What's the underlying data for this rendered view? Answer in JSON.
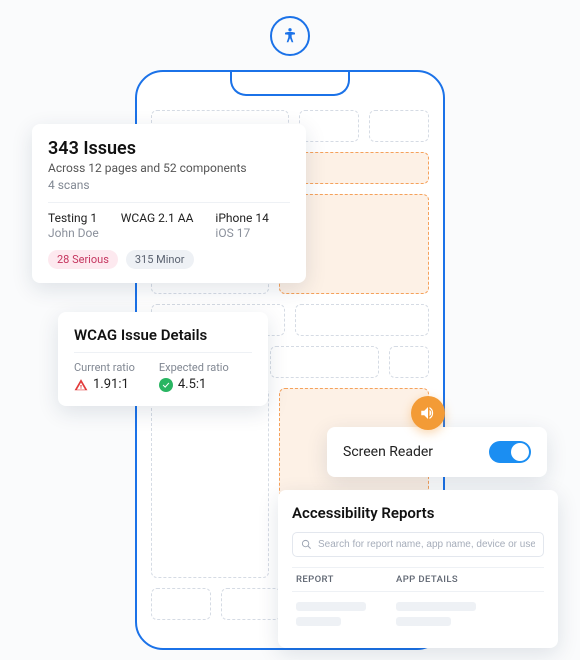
{
  "issues": {
    "title": "343 Issues",
    "subtitle": "Across 12 pages and 52 components",
    "scans": "4 scans",
    "meta": [
      {
        "line1": "Testing 1",
        "line2": "John Doe"
      },
      {
        "line1": "WCAG 2.1 AA",
        "line2": ""
      },
      {
        "line1": "iPhone 14",
        "line2": "iOS 17"
      }
    ],
    "badges": {
      "serious": "28 Serious",
      "minor": "315 Minor"
    }
  },
  "wcag": {
    "title": "WCAG Issue Details",
    "current": {
      "label": "Current ratio",
      "value": "1.91:1"
    },
    "expected": {
      "label": "Expected ratio",
      "value": "4.5:1"
    }
  },
  "screenReader": {
    "label": "Screen Reader",
    "enabled": true
  },
  "reports": {
    "title": "Accessibility Reports",
    "searchPlaceholder": "Search for report name, app name, device or users",
    "columns": {
      "report": "REPORT",
      "appDetails": "APP DETAILS"
    }
  }
}
